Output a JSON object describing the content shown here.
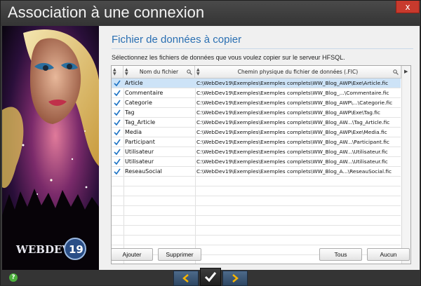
{
  "window": {
    "title": "Association à une connexion",
    "close_label": "x"
  },
  "panel": {
    "heading": "Fichier de données à copier",
    "instruction": "Sélectionnez les fichiers de données que vous voulez copier sur le serveur HFSQL."
  },
  "table": {
    "columns": {
      "name": "Nom du fichier",
      "path": "Chemin physique du fichier de données (.FIC)"
    },
    "rows": [
      {
        "checked": true,
        "name": "Article",
        "path": "C:\\WebDev19\\Exemples\\Exemples complets\\WW_Blog_AWP\\Exe\\Article.fic"
      },
      {
        "checked": true,
        "name": "Commentaire",
        "path": "C:\\WebDev19\\Exemples\\Exemples complets\\WW_Blog_...\\Commentaire.fic"
      },
      {
        "checked": true,
        "name": "Categorie",
        "path": "C:\\WebDev19\\Exemples\\Exemples complets\\WW_Blog_AWP\\...\\Categorie.fic"
      },
      {
        "checked": true,
        "name": "Tag",
        "path": "C:\\WebDev19\\Exemples\\Exemples complets\\WW_Blog_AWP\\Exe\\Tag.fic"
      },
      {
        "checked": true,
        "name": "Tag_Article",
        "path": "C:\\WebDev19\\Exemples\\Exemples complets\\WW_Blog_AW...\\Tag_Article.fic"
      },
      {
        "checked": true,
        "name": "Media",
        "path": "C:\\WebDev19\\Exemples\\Exemples complets\\WW_Blog_AWP\\Exe\\Media.fic"
      },
      {
        "checked": true,
        "name": "Participant",
        "path": "C:\\WebDev19\\Exemples\\Exemples complets\\WW_Blog_AW...\\Participant.fic"
      },
      {
        "checked": true,
        "name": "Utilisateur",
        "path": "C:\\WebDev19\\Exemples\\Exemples complets\\WW_Blog_AW...\\Utilisateur.fic"
      },
      {
        "checked": true,
        "name": "Utilisateur",
        "path": "C:\\WebDev19\\Exemples\\Exemples complets\\WW_Blog_AW...\\Utilisateur.fic"
      },
      {
        "checked": true,
        "name": "ReseauSocial",
        "path": "C:\\WebDev19\\Exemples\\Exemples complets\\WW_Blog_A...\\ReseauSocial.fic"
      }
    ]
  },
  "buttons": {
    "add": "Ajouter",
    "remove": "Supprimer",
    "all": "Tous",
    "none": "Aucun"
  },
  "branding": {
    "logo_text": "WEBDEV",
    "version": "19"
  },
  "footer": {
    "help_glyph": "?"
  },
  "colors": {
    "accent": "#2a6fb2",
    "selected_row": "#cde3f7",
    "check": "#1c72c4",
    "nav": "#f5b400"
  }
}
